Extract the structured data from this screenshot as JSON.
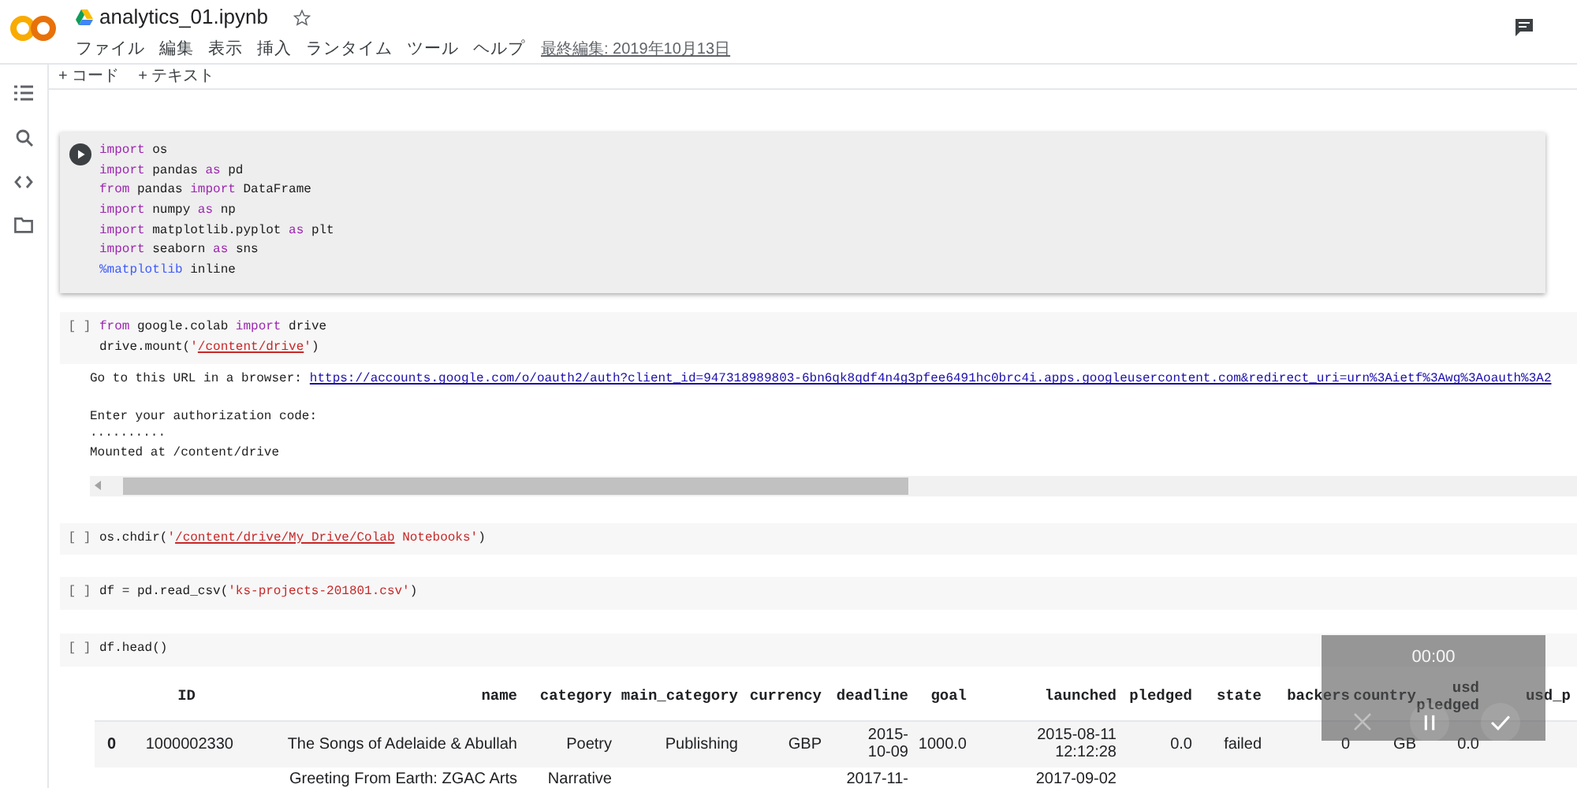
{
  "header": {
    "title": "analytics_01.ipynb",
    "starred": false,
    "menus": [
      "ファイル",
      "編集",
      "表示",
      "挿入",
      "ランタイム",
      "ツール",
      "ヘルプ"
    ],
    "last_edited": "最終編集: 2019年10月13日"
  },
  "toolbar": {
    "buttons": [
      "+ コード",
      "+ テキスト"
    ]
  },
  "cells": [
    {
      "selected": true,
      "lines": [
        [
          {
            "kind": "kw",
            "text": "import"
          },
          {
            "kind": "text",
            "text": " os"
          }
        ],
        [
          {
            "kind": "kw",
            "text": "import"
          },
          {
            "kind": "text",
            "text": " pandas "
          },
          {
            "kind": "kw",
            "text": "as"
          },
          {
            "kind": "text",
            "text": " pd"
          }
        ],
        [
          {
            "kind": "kw",
            "text": "from"
          },
          {
            "kind": "text",
            "text": " pandas "
          },
          {
            "kind": "kw",
            "text": "import"
          },
          {
            "kind": "text",
            "text": " DataFrame"
          }
        ],
        [
          {
            "kind": "kw",
            "text": "import"
          },
          {
            "kind": "text",
            "text": " numpy "
          },
          {
            "kind": "kw",
            "text": "as"
          },
          {
            "kind": "text",
            "text": " np"
          }
        ],
        [
          {
            "kind": "kw",
            "text": "import"
          },
          {
            "kind": "text",
            "text": " matplotlib.pyplot "
          },
          {
            "kind": "kw",
            "text": "as"
          },
          {
            "kind": "text",
            "text": " plt"
          }
        ],
        [
          {
            "kind": "kw",
            "text": "import"
          },
          {
            "kind": "text",
            "text": " seaborn "
          },
          {
            "kind": "kw",
            "text": "as"
          },
          {
            "kind": "text",
            "text": " sns"
          }
        ],
        [
          {
            "kind": "magic",
            "text": "%matplotlib"
          },
          {
            "kind": "text",
            "text": " inline"
          }
        ]
      ]
    },
    {
      "selected": false,
      "exec": "[ ]",
      "lines": [
        [
          {
            "kind": "kw",
            "text": "from"
          },
          {
            "kind": "text",
            "text": " google.colab "
          },
          {
            "kind": "kw",
            "text": "import"
          },
          {
            "kind": "text",
            "text": " drive"
          }
        ],
        [
          {
            "kind": "text",
            "text": "drive.mount("
          },
          {
            "kind": "str",
            "text": "'"
          },
          {
            "kind": "path",
            "text": "/content/drive"
          },
          {
            "kind": "str",
            "text": "'"
          },
          {
            "kind": "text",
            "text": ")"
          }
        ]
      ],
      "output": {
        "url_prompt": "Go to this URL in a browser:",
        "url": "https://accounts.google.com/o/oauth2/auth?client_id=947318989803-6bn6qk8qdf4n4g3pfee6491hc0brc4i.apps.googleusercontent.com&redirect_uri=urn%3Aietf%3Awg%3Aoauth%3A2",
        "lines": [
          "Enter your authorization code:",
          "··········",
          "Mounted at /content/drive"
        ]
      }
    },
    {
      "selected": false,
      "exec": "[ ]",
      "lines": [
        [
          {
            "kind": "text",
            "text": "os.chdir("
          },
          {
            "kind": "str",
            "text": "'"
          },
          {
            "kind": "path",
            "text": "/content/drive/My Drive/Colab"
          },
          {
            "kind": "str",
            "text": " Notebooks'"
          },
          {
            "kind": "text",
            "text": ")"
          }
        ]
      ]
    },
    {
      "selected": false,
      "exec": "[ ]",
      "lines": [
        [
          {
            "kind": "text",
            "text": "df = pd.read_csv("
          },
          {
            "kind": "str",
            "text": "'ks-projects-201801.csv'"
          },
          {
            "kind": "text",
            "text": ")"
          }
        ]
      ]
    },
    {
      "selected": false,
      "exec": "[ ]",
      "lines": [
        [
          {
            "kind": "text",
            "text": "df.head()"
          }
        ]
      ]
    }
  ],
  "table": {
    "columns": [
      "ID",
      "name",
      "category",
      "main_category",
      "currency",
      "deadline",
      "goal",
      "launched",
      "pledged",
      "state",
      "backers",
      "country",
      "usd pledged",
      "usd_p"
    ],
    "rows": [
      {
        "index": "0",
        "cells": [
          "1000002330",
          "The Songs of Adelaide & Abullah",
          "Poetry",
          "Publishing",
          "GBP",
          "2015-10-09",
          "1000.0",
          "2015-08-11 12:12:28",
          "0.0",
          "failed",
          "0",
          "GB",
          "0.0"
        ]
      },
      {
        "cells": [
          null,
          "Greeting From Earth: ZGAC Arts",
          "Narrative",
          null,
          null,
          "2017-11-",
          null,
          "2017-09-02"
        ]
      }
    ]
  },
  "recorder": {
    "time": "00:00"
  }
}
